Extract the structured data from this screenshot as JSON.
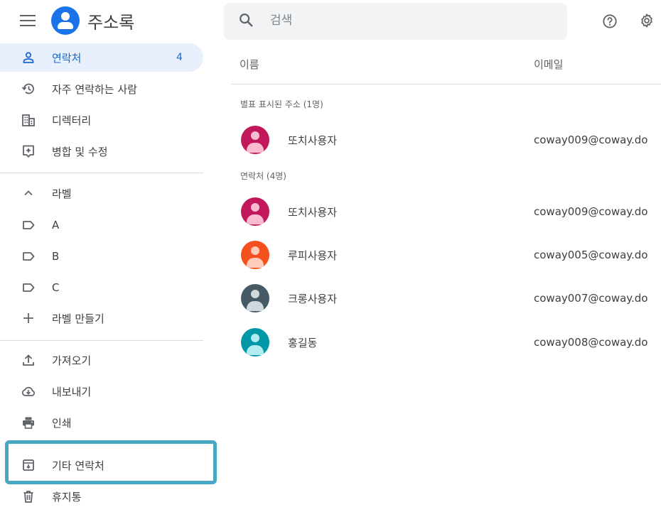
{
  "header": {
    "app_title": "주소록",
    "search_placeholder": "검색"
  },
  "sidebar": {
    "primary": [
      {
        "label": "연락처",
        "icon": "person-icon",
        "count": "4"
      },
      {
        "label": "자주 연락하는 사람",
        "icon": "history-icon"
      },
      {
        "label": "디렉터리",
        "icon": "building-icon"
      },
      {
        "label": "병합 및 수정",
        "icon": "merge-fix-icon"
      }
    ],
    "labels_header": "라벨",
    "labels": [
      {
        "label": "A",
        "icon": "label-icon"
      },
      {
        "label": "B",
        "icon": "label-icon"
      },
      {
        "label": "C",
        "icon": "label-icon"
      }
    ],
    "create_label": "라벨 만들기",
    "secondary": [
      {
        "label": "가져오기",
        "icon": "upload-icon"
      },
      {
        "label": "내보내기",
        "icon": "cloud-download-icon"
      },
      {
        "label": "인쇄",
        "icon": "print-icon"
      },
      {
        "label": "기타 연락처",
        "icon": "archive-icon"
      },
      {
        "label": "휴지통",
        "icon": "trash-icon"
      }
    ]
  },
  "main": {
    "columns": {
      "name": "이름",
      "email": "이메일"
    },
    "starred_section": {
      "title": "별표 표시된 주소 (1명)",
      "contacts": [
        {
          "name": "또치사용자",
          "email": "coway009@coway.do",
          "avatar_color": "#c2185b"
        }
      ]
    },
    "contacts_section": {
      "title": "연락처 (4명)",
      "contacts": [
        {
          "name": "또치사용자",
          "email": "coway009@coway.do",
          "avatar_color": "#c2185b"
        },
        {
          "name": "루피사용자",
          "email": "coway005@coway.do",
          "avatar_color": "#f4511e"
        },
        {
          "name": "크롱사용자",
          "email": "coway007@coway.do",
          "avatar_color": "#455a64"
        },
        {
          "name": "홍길동",
          "email": "coway008@coway.do",
          "avatar_color": "#0097a7"
        }
      ]
    }
  },
  "colors": {
    "accent": "#1a73e8",
    "active_nav_bg": "#e8f0fe",
    "highlight_border": "#46a8c3"
  }
}
